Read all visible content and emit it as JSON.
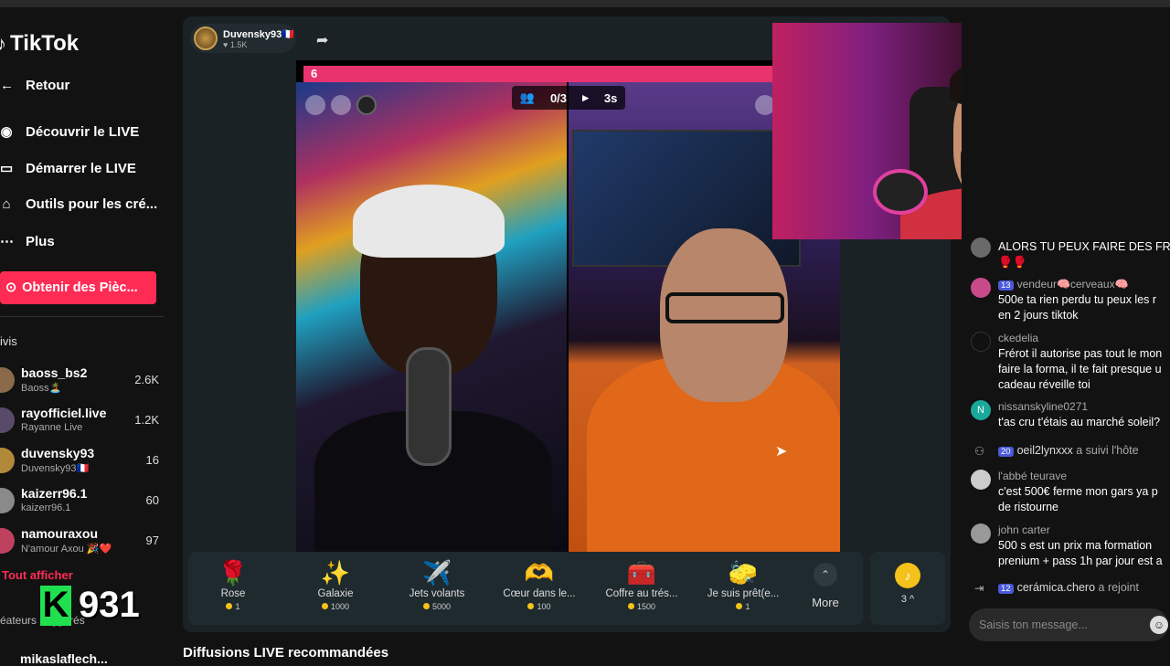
{
  "app": {
    "logo": "TikTok"
  },
  "sidebar": {
    "back": "Retour",
    "nav": [
      {
        "label": "Découvrir le LIVE",
        "icon": "live-icon"
      },
      {
        "label": "Démarrer le LIVE",
        "icon": "camera-icon"
      },
      {
        "label": "Outils pour les cré...",
        "icon": "home-icon"
      },
      {
        "label": "Plus",
        "icon": "more-icon"
      }
    ],
    "coins_button": "Obtenir des Pièc...",
    "following_heading": "ivis",
    "following": [
      {
        "name": "baoss_bs2",
        "sub": "Baoss🏝️",
        "count": "2.6K"
      },
      {
        "name": "rayofficiel.live",
        "sub": "Rayanne Live",
        "count": "1.2K"
      },
      {
        "name": "duvensky93",
        "sub": "Duvensky93🇫🇷",
        "count": "16"
      },
      {
        "name": "kaizerr96.1",
        "sub": "kaizerr96.1",
        "count": "60"
      },
      {
        "name": "namouraxou",
        "sub": "N'amour Axou 🎉❤️",
        "count": "97"
      }
    ],
    "show_all": "Tout afficher",
    "creators_heading": "éateurs suggérés",
    "bottom_name": "mikaslaflech..."
  },
  "overlay": {
    "letter": "K",
    "number": "931"
  },
  "live": {
    "host_name": "Duvensky93🇫🇷",
    "host_likes": "♥ 1.5K",
    "pk_score": "6",
    "pk_count": "0/3",
    "pk_timer": "3s"
  },
  "gifts": [
    {
      "name": "Rose",
      "price": "1",
      "icon": "🌹"
    },
    {
      "name": "Galaxie",
      "price": "1000",
      "icon": "✨"
    },
    {
      "name": "Jets volants",
      "price": "5000",
      "icon": "✈️"
    },
    {
      "name": "Cœur dans le...",
      "price": "100",
      "icon": "🫶"
    },
    {
      "name": "Coffre au trés...",
      "price": "1500",
      "icon": "🧰"
    },
    {
      "name": "Je suis prêt(e...",
      "price": "1",
      "icon": "🧽"
    }
  ],
  "gifts_more": "More",
  "coins_balance": "3 ^",
  "recommended": "Diffusions LIVE recommandées",
  "chat": {
    "messages": [
      {
        "user": "",
        "badge": "",
        "text": "ALORS TU PEUX FAIRE DES FRIT\n🥊🥊",
        "avatar_color": "#6a6a6a"
      },
      {
        "user": "vendeur🧠cerveaux🧠",
        "badge": "13",
        "text": "500e ta rien perdu tu peux les r\nen 2 jours tiktok",
        "avatar_color": "#c94a8a"
      },
      {
        "user": "ckedelia",
        "badge": "",
        "text": "Frérot il autorise pas tout le mon\nfaire la forma, il te fait presque u\ncadeau réveille toi",
        "avatar_color": "#111111"
      },
      {
        "user": "nissanskyline0271",
        "badge": "",
        "text": "t'as cru t'étais au marché soleil?",
        "avatar_color": "#1aa89a"
      },
      {
        "user": "l'abbé teurave",
        "badge": "",
        "text": "c'est 500€ ferme mon gars ya p\nde ristourne",
        "avatar_color": "#cccccc"
      },
      {
        "user": "john carter",
        "badge": "",
        "text": "500 s est un prix ma formation\nprenium + pass 1h par jour est a",
        "avatar_color": "#999999"
      }
    ],
    "follow_event": {
      "badge": "20",
      "user": "oeil2lynxxx",
      "text": "a suivi l'hôte"
    },
    "join_event": {
      "badge": "12",
      "user": "cerámica.chero",
      "text": "a rejoint"
    },
    "input_placeholder": "Saisis ton message..."
  }
}
